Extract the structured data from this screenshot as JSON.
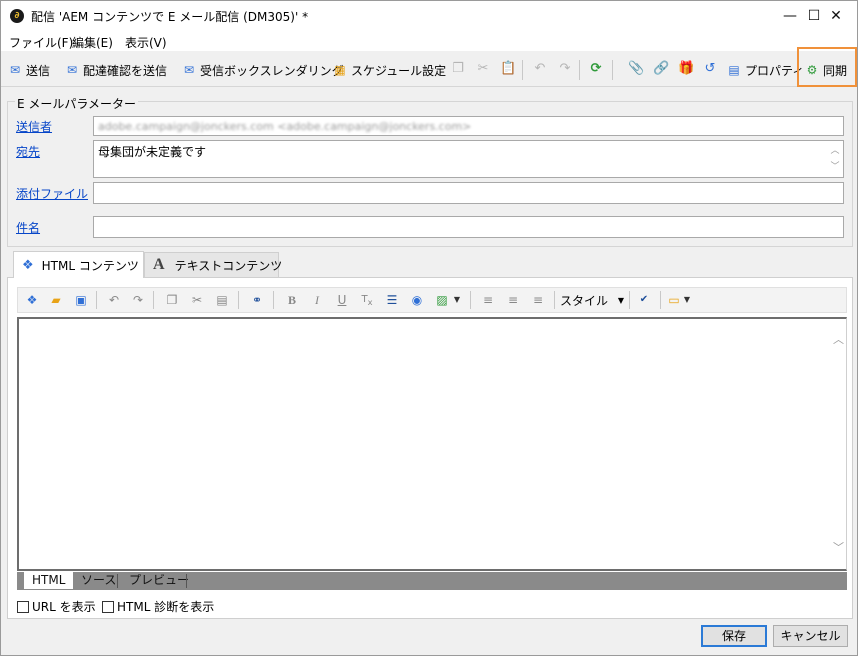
{
  "window": {
    "title": "配信 'AEM コンテンツで E メール配信 (DM305)' *",
    "app_icon_glyph": "∂",
    "controls": {
      "minimize": "—",
      "maximize": "☐",
      "close": "✕"
    }
  },
  "menu": [
    {
      "label": "ファイル(F)"
    },
    {
      "label": "編集(E)"
    },
    {
      "label": "表示(V)"
    }
  ],
  "toolbar": {
    "send": "送信",
    "send_proof": "配達確認を送信",
    "inbox_rendering": "受信ボックスレンダリング",
    "schedule": "スケジュール設定",
    "properties": "プロパティ",
    "sync": "同期",
    "colors": {
      "blue": "#2f6fd6",
      "green": "#2f9a3a",
      "orange": "#e8a317",
      "gray": "#a8a8a8"
    }
  },
  "email_params": {
    "legend": "E メールパラメーター",
    "sender_label": "送信者",
    "sender_value": "adobe.campaign@jonckers.com <adobe.campaign@jonckers.com>",
    "to_label": "宛先",
    "to_value": "母集団が未定義です",
    "attachment_label": "添付ファイル",
    "attachment_value": "",
    "subject_label": "件名",
    "subject_value": ""
  },
  "content_tabs": [
    {
      "label": "HTML コンテンツ",
      "active": true
    },
    {
      "label": "テキストコンテンツ",
      "active": false
    }
  ],
  "editor_toolbar": {
    "style_label": "スタイル"
  },
  "editor": {
    "body": ""
  },
  "view_tabs": [
    {
      "label": "HTML",
      "active": true
    },
    {
      "label": "ソース",
      "active": false
    },
    {
      "label": "プレビュー",
      "active": false
    }
  ],
  "options": {
    "show_url": "URL を表示",
    "show_html_diagnostics": "HTML 診断を表示"
  },
  "buttons": {
    "save": "保存",
    "cancel": "キャンセル"
  }
}
